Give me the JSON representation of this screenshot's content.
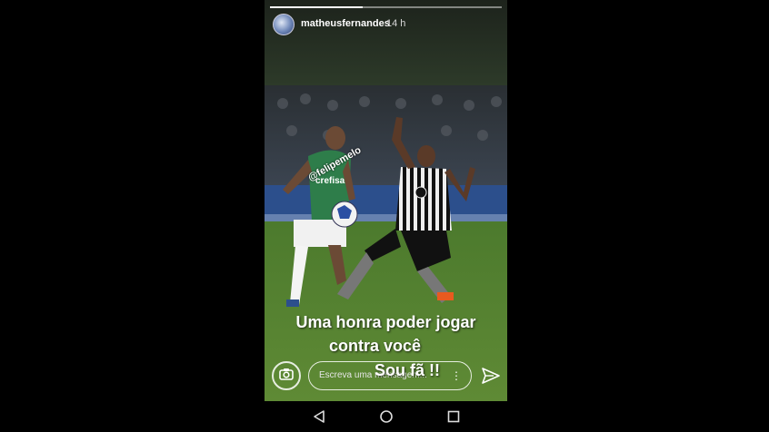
{
  "story": {
    "username": "matheusfernandes",
    "timestamp": "14 h",
    "progress": 0.4,
    "mention": "@felipemelo",
    "caption_line1": "Uma honra poder jogar",
    "caption_line2": "contra você",
    "caption_line3": "Sou fã !!",
    "message_placeholder": "Escreva uma mensagem...",
    "camera_icon": "camera-icon",
    "send_icon": "send-icon",
    "more_icon": "kebab-menu-icon"
  },
  "navbar": {
    "back_icon": "nav-back-icon",
    "home_icon": "nav-home-icon",
    "recents_icon": "nav-recents-icon"
  },
  "colors": {
    "background": "#000000",
    "palmeiras_green": "#2e7d4a",
    "botafogo_black": "#111111",
    "pitch_green": "#4f7f2e"
  }
}
